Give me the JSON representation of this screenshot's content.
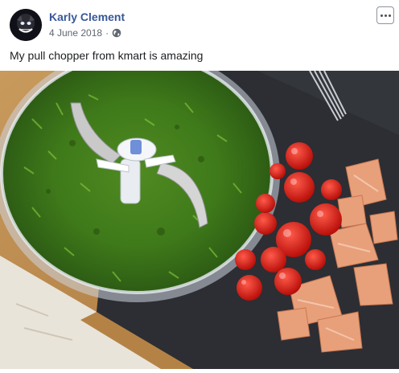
{
  "post": {
    "author": "Karly Clement",
    "date": "4 June 2018",
    "separator": "·",
    "privacy_icon": "globe-icon",
    "more_icon": "more-options-icon",
    "text": "My pull chopper from kmart is amazing"
  },
  "photo": {
    "subject": "pull chopper with chopped herbs, tomatoes and salmon"
  },
  "colors": {
    "author_link": "#385898",
    "meta": "#606770"
  }
}
